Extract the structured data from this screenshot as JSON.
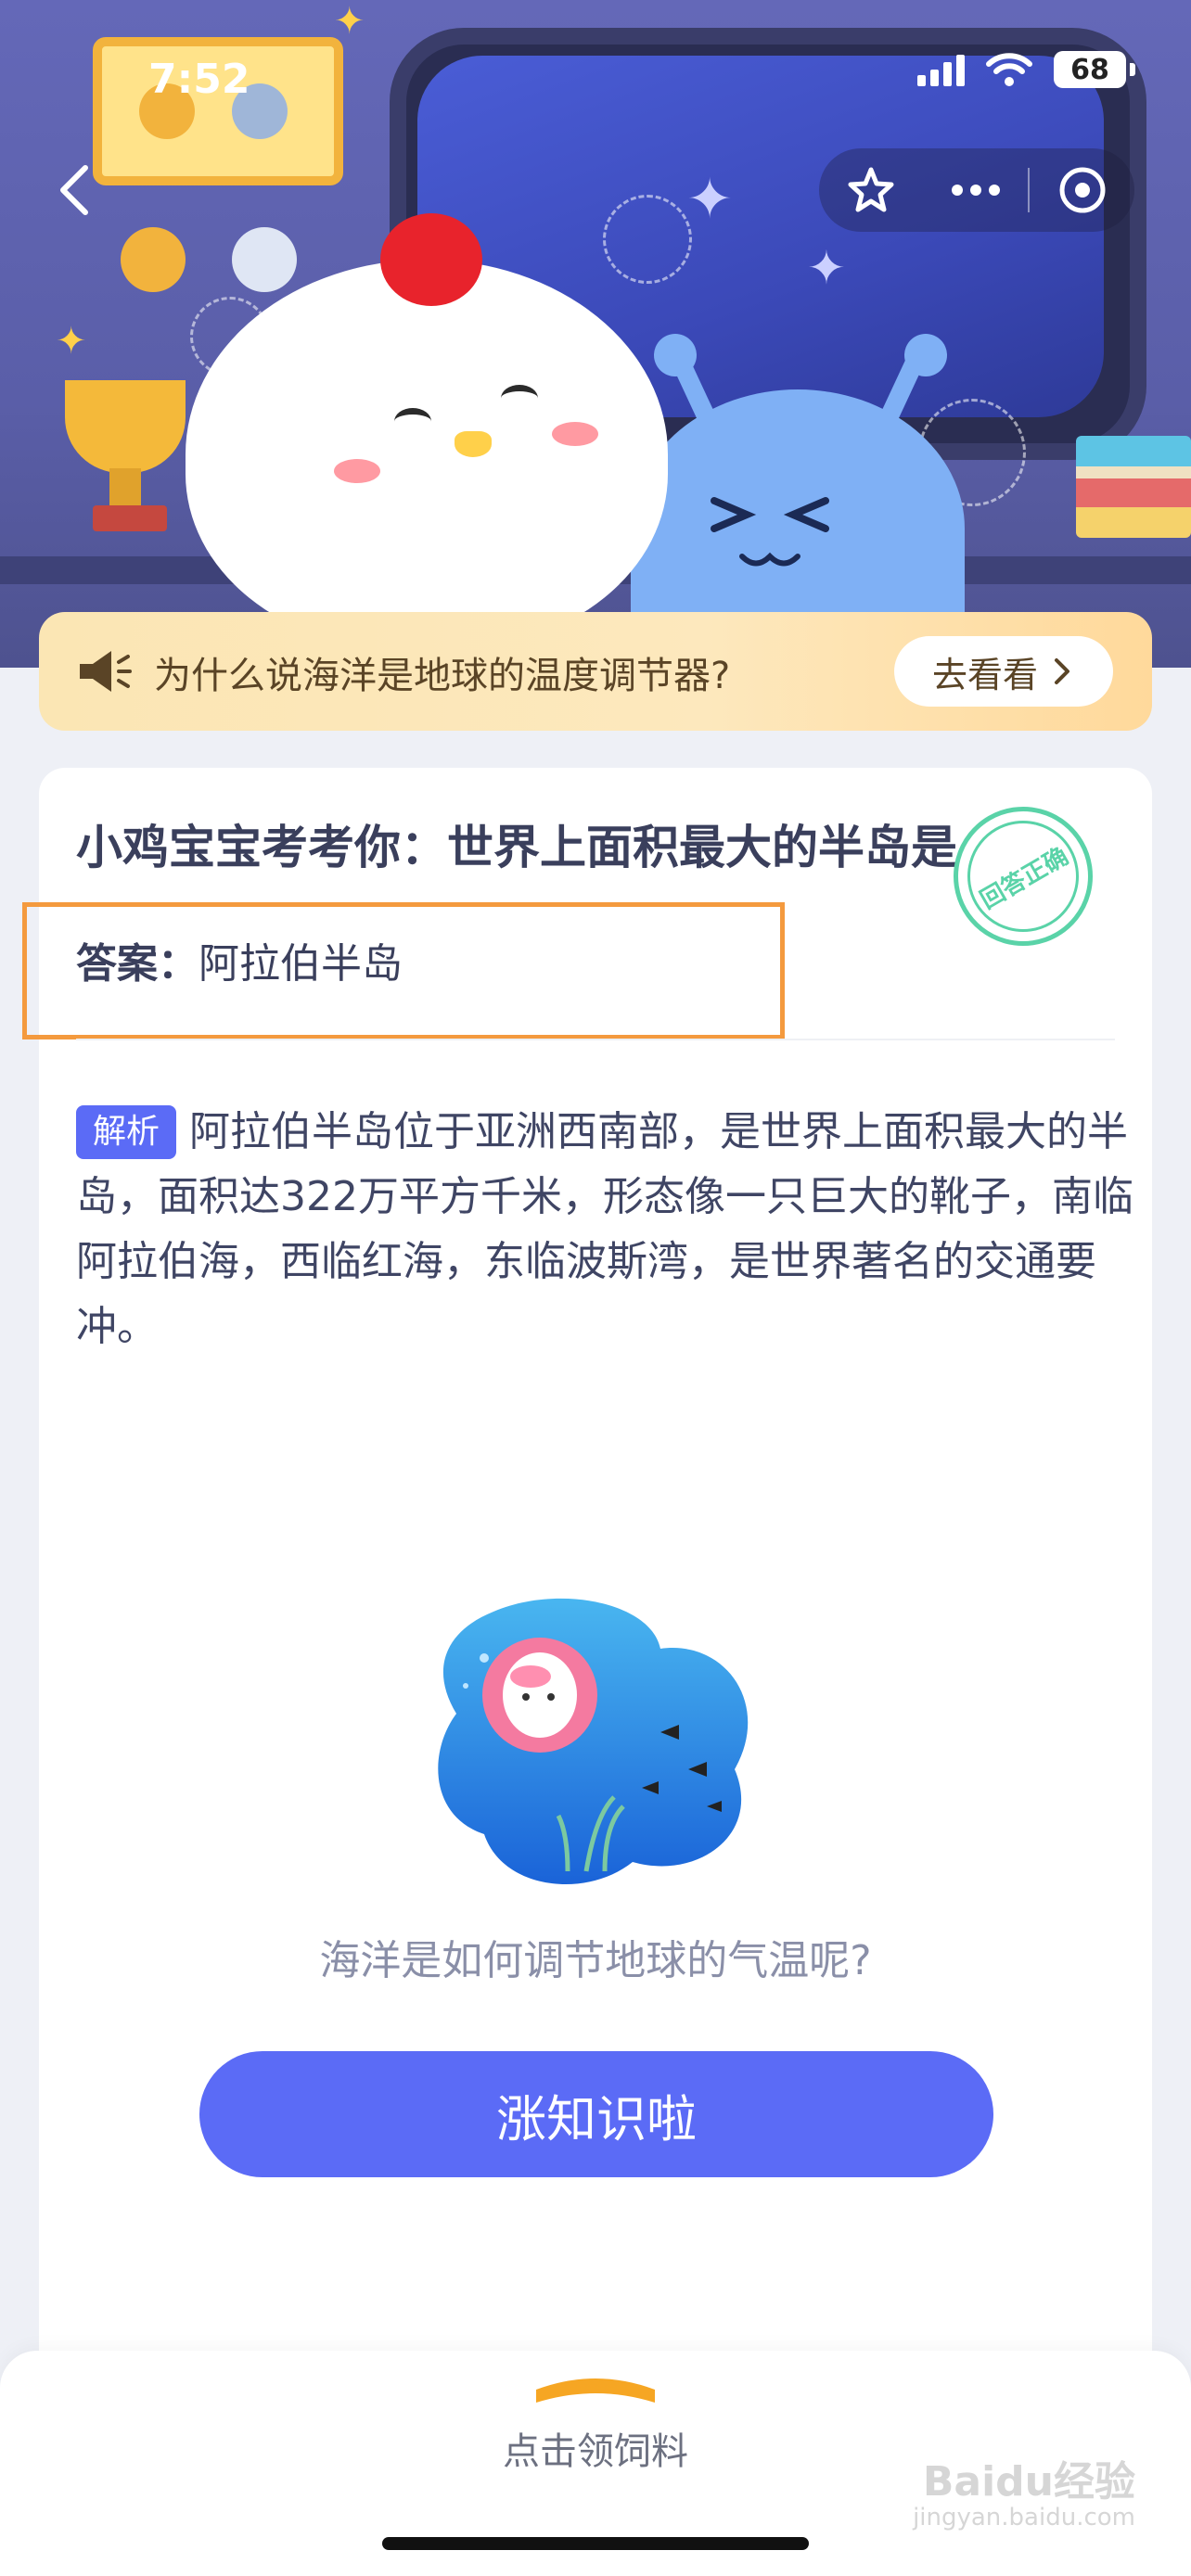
{
  "status_bar": {
    "time": "7:52",
    "battery": "68"
  },
  "notice": {
    "text": "为什么说海洋是地球的温度调节器?",
    "button": "去看看"
  },
  "card": {
    "question": "小鸡宝宝考考你：世界上面积最大的半岛是",
    "stamp_text": "回答正确",
    "answer_label": "答案：",
    "answer_value": "阿拉伯半岛",
    "analysis_tag": "解析",
    "analysis_text": "阿拉伯半岛位于亚洲西南部，是世界上面积最大的半岛，面积达322万平方千米，形态像一只巨大的靴子，南临阿拉伯海，西临红海，东临波斯湾，是世界著名的交通要冲。",
    "sub_question": "海洋是如何调节地球的气温呢?",
    "cta": "涨知识啦"
  },
  "bottom": {
    "feed_label": "点击领饲料"
  },
  "watermark": {
    "main": "Baidu经验",
    "sub": "jingyan.baidu.com"
  },
  "colors": {
    "accent": "#5b6bf6",
    "highlight_box": "#f49a3e",
    "stamp": "#5ad3a8"
  }
}
